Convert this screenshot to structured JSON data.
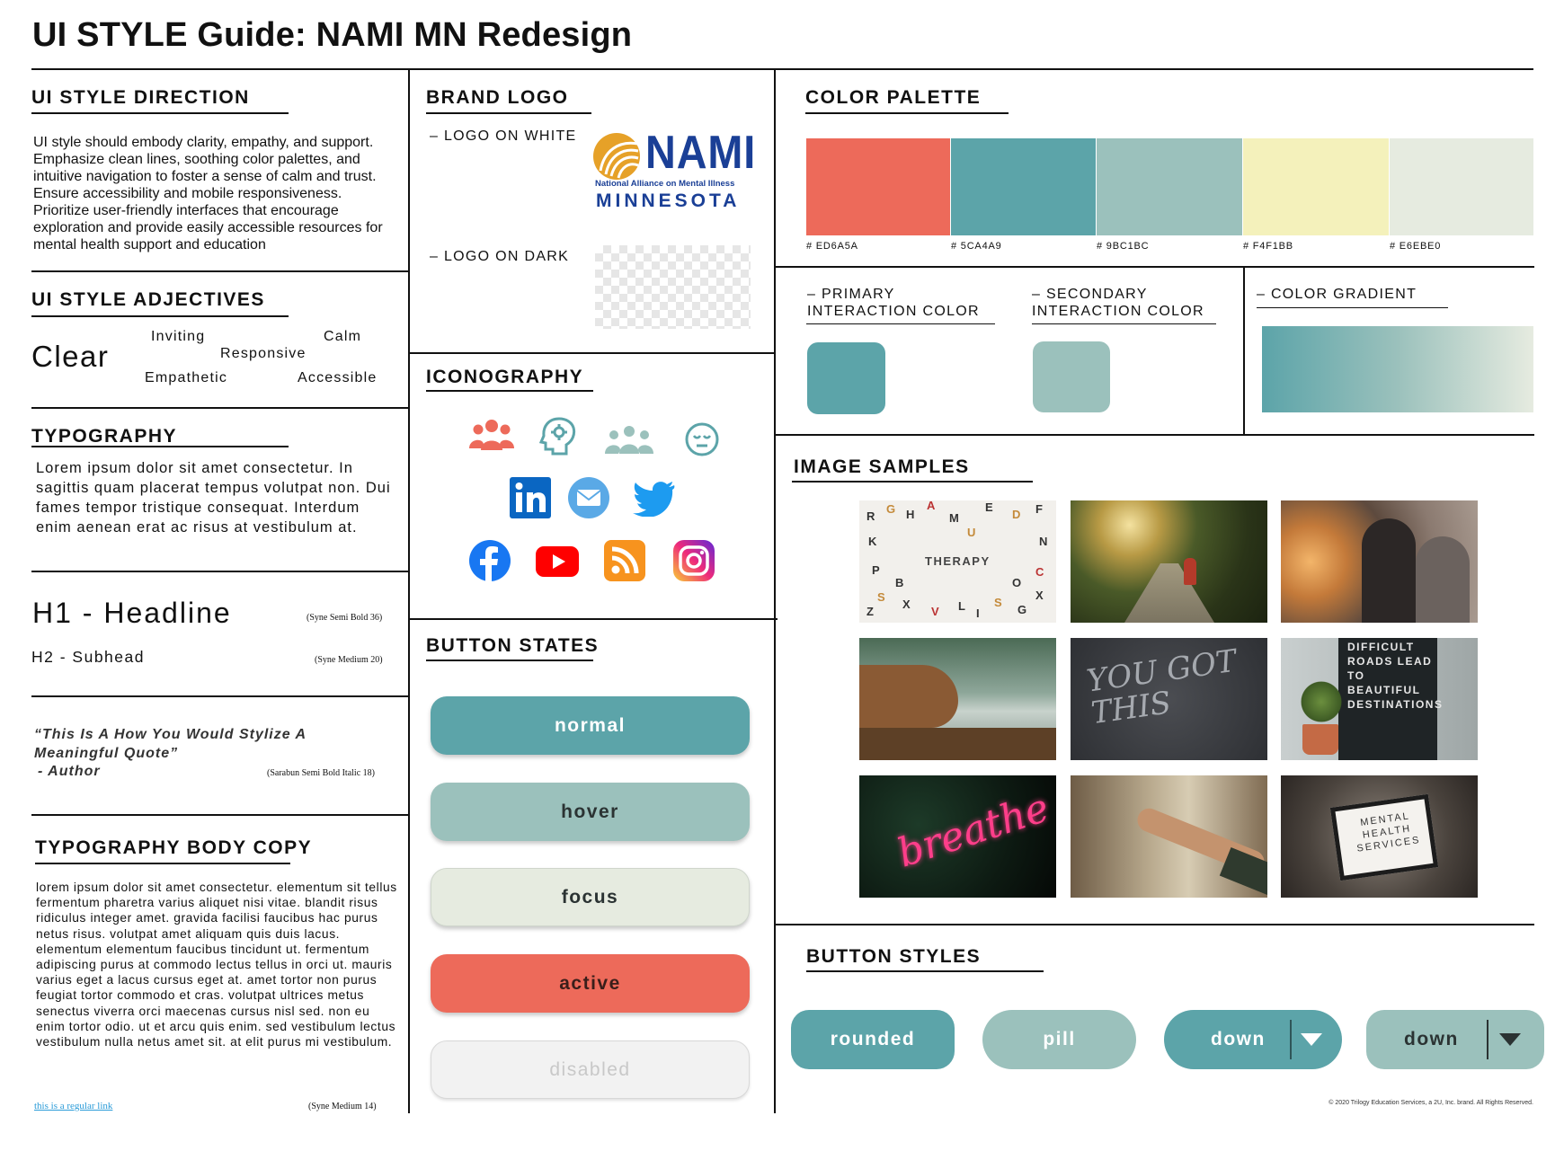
{
  "title": "UI STYLE Guide: NAMI MN Redesign",
  "direction": {
    "heading": "UI STYLE DIRECTION",
    "text": "UI style should embody clarity, empathy, and support. Emphasize clean lines, soothing color palettes, and intuitive navigation to foster a sense of calm and trust. Ensure accessibility and mobile responsiveness. Prioritize user-friendly interfaces that encourage exploration and provide easily accessible resources for mental health support and education"
  },
  "adjectives": {
    "heading": "UI STYLE ADJECTIVES",
    "main": "Clear",
    "inviting": "Inviting",
    "calm": "Calm",
    "responsive": "Responsive",
    "empathetic": "Empathetic",
    "accessible": "Accessible"
  },
  "typography": {
    "heading": "TYPOGRAPHY",
    "sample": "Lorem ipsum dolor sit amet consectetur. In sagittis quam placerat tempus volutpat non. Dui fames tempor tristique consequat. Interdum enim aenean erat ac risus at vestibulum at.",
    "h1": "H1 - Headline",
    "h1_note": "(Syne Semi Bold 36)",
    "h2": "H2 - Subhead",
    "h2_note": "(Syne Medium 20)",
    "quote": "“This Is A How You Would Stylize A Meaningful Quote”",
    "author": "- Author",
    "quote_note": "(Sarabun Semi Bold Italic 18)"
  },
  "body_copy": {
    "heading": "TYPOGRAPHY BODY COPY",
    "text": "lorem ipsum dolor sit amet consectetur. elementum sit tellus fermentum pharetra varius aliquet nisi vitae. blandit risus ridiculus integer amet. gravida facilisi faucibus hac purus netus risus. volutpat amet aliquam quis duis lacus. elementum elementum faucibus tincidunt ut. fermentum adipiscing purus at commodo lectus tellus in orci ut. mauris varius eget a lacus cursus eget at. amet tortor non purus feugiat tortor commodo et cras. volutpat ultrices metus senectus viverra orci maecenas cursus nisl sed. non eu enim tortor odio. ut et arcu quis enim. sed vestibulum lectus vestibulum nulla netus amet sit. at elit purus mi vestibulum.",
    "link": "this is a regular link",
    "link_note": "(Syne Medium 14)"
  },
  "brand": {
    "heading": "BRAND LOGO",
    "on_white": "– LOGO ON WHITE",
    "on_dark": "– LOGO ON DARK",
    "logo_name": "NAMI",
    "logo_sub": "National Alliance on Mental Illness",
    "logo_state": "MINNESOTA"
  },
  "iconography": {
    "heading": "ICONOGRAPHY"
  },
  "button_states": {
    "heading": "BUTTON STATES",
    "normal": "normal",
    "hover": "hover",
    "focus": "focus",
    "active": "active",
    "disabled": "disabled"
  },
  "palette": {
    "heading": "COLOR PALETTE",
    "colors": [
      {
        "hex": "# ED6A5A",
        "value": "#ED6A5A"
      },
      {
        "hex": "# 5CA4A9",
        "value": "#5CA4A9"
      },
      {
        "hex": "# 9BC1BC",
        "value": "#9BC1BC"
      },
      {
        "hex": "# F4F1BB",
        "value": "#F4F1BB"
      },
      {
        "hex": "# E6EBE0",
        "value": "#E6EBE0"
      }
    ]
  },
  "interaction": {
    "primary": "– PRIMARY\nINTERACTION COLOR",
    "secondary": "– SECONDARY\nINTERACTION COLOR",
    "gradient": "– COLOR GRADIENT"
  },
  "images": {
    "heading": "IMAGE SAMPLES",
    "therapy": "THERAPY",
    "you_got_this": "YOU GOT THIS",
    "difficult_roads": "DIFFICULT ROADS LEAD TO BEAUTIFUL DESTINATIONS",
    "breathe": "breathe",
    "mental_health": "MENTAL HEALTH SERVICES"
  },
  "button_styles": {
    "heading": "BUTTON STYLES",
    "rounded": "rounded",
    "pill": "pill",
    "down1": "down",
    "down2": "down"
  },
  "footer": "© 2020 Trilogy Education Services, a 2U, Inc. brand. All Rights Reserved."
}
